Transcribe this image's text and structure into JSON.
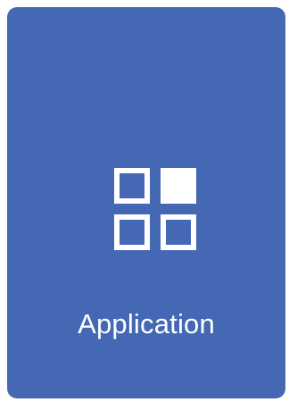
{
  "tile": {
    "label": "Application",
    "icon": "apps-grid-icon",
    "background_color": "#4468b4",
    "text_color": "#ffffff"
  }
}
